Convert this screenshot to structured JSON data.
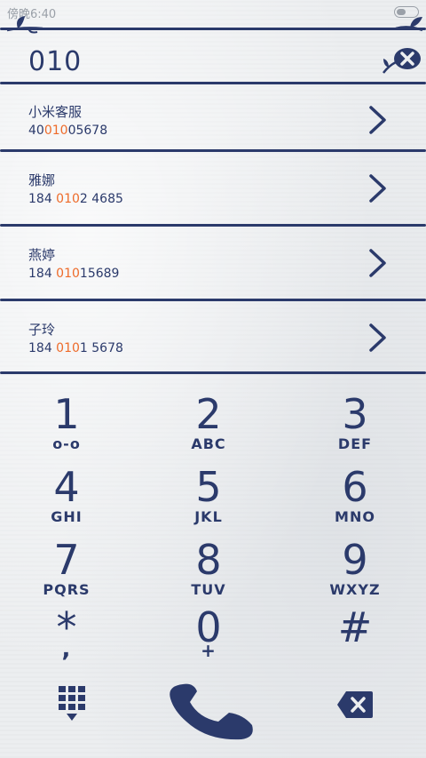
{
  "status_bar": {
    "time": "傍晚6:40"
  },
  "dialer": {
    "input_value": "010"
  },
  "contacts": [
    {
      "name": "小米客服",
      "number_pre": "40",
      "number_match": "010",
      "number_post": "05678"
    },
    {
      "name": "雅娜",
      "number_pre": "184 ",
      "number_match": "010",
      "number_post": "2 4685"
    },
    {
      "name": "燕婷",
      "number_pre": "184 ",
      "number_match": "010",
      "number_post": "15689"
    },
    {
      "name": "子玲",
      "number_pre": "184 ",
      "number_match": "010",
      "number_post": "1 5678"
    }
  ],
  "keypad": [
    {
      "digit": "1",
      "letters": "o-o"
    },
    {
      "digit": "2",
      "letters": "ABC"
    },
    {
      "digit": "3",
      "letters": "DEF"
    },
    {
      "digit": "4",
      "letters": "GHI"
    },
    {
      "digit": "5",
      "letters": "JKL"
    },
    {
      "digit": "6",
      "letters": "MNO"
    },
    {
      "digit": "7",
      "letters": "PQRS"
    },
    {
      "digit": "8",
      "letters": "TUV"
    },
    {
      "digit": "9",
      "letters": "WXYZ"
    },
    {
      "digit": "*",
      "letters": ","
    },
    {
      "digit": "0",
      "letters": "+"
    },
    {
      "digit": "#",
      "letters": ""
    }
  ],
  "icons": {
    "clear": "leaf-clear-icon",
    "chevron": "chevron-right-icon",
    "keypad_toggle": "keypad-grid-icon",
    "call": "phone-handset-icon",
    "backspace": "backspace-icon"
  },
  "colors": {
    "ink": "#2b3a6b",
    "highlight": "#ee6b2a",
    "paper": "#eceef0"
  }
}
